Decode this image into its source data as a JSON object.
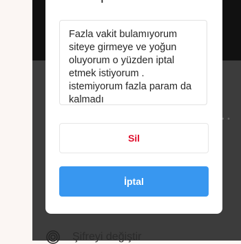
{
  "modal": {
    "title": "İptal sebebi:",
    "reason_text": "Fazla vakit bulamıyorum siteye girmeye ve yoğun oluyorum o yüzden iptal etmek istiyorum . istemiyorum fazla param da kalmadı",
    "delete_label": "Sil",
    "cancel_label": "İptal"
  },
  "background": {
    "menu_item_label": "Şifreyi değiştir",
    "menu_item_icon": "fingerprint-icon"
  },
  "colors": {
    "delete_text": "#e0102e",
    "cancel_bg": "#3897f0"
  }
}
